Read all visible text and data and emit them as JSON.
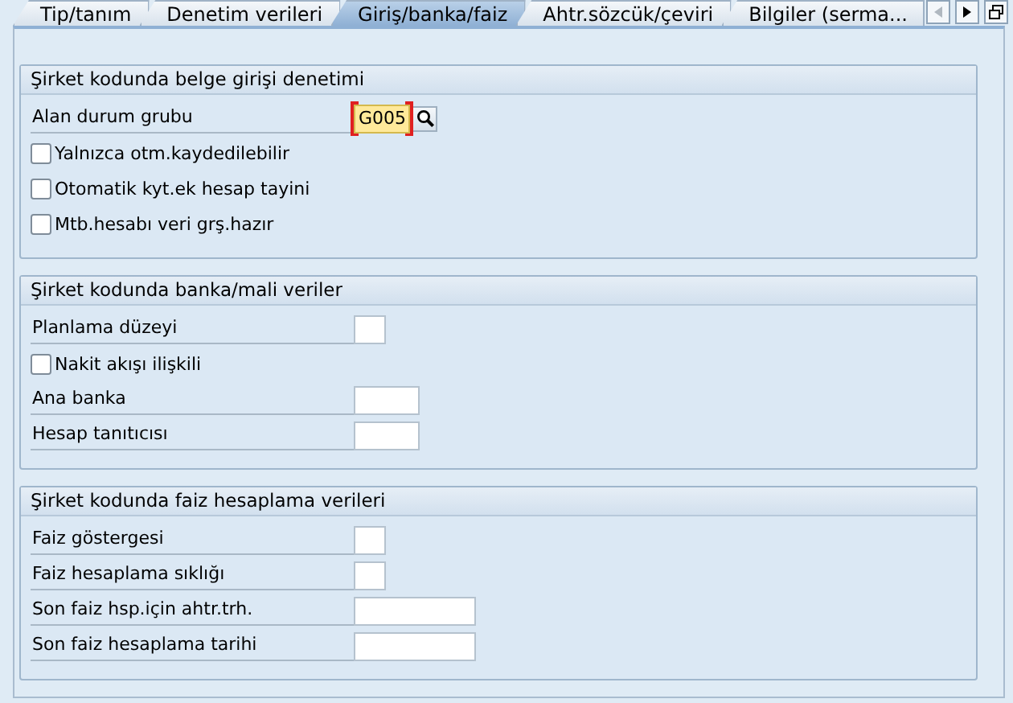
{
  "tabs": [
    {
      "label": "Tip/tanım",
      "selected": false
    },
    {
      "label": "Denetim verileri",
      "selected": false
    },
    {
      "label": "Giriş/banka/faiz",
      "selected": true
    },
    {
      "label": "Ahtr.sözcük/çeviri",
      "selected": false
    },
    {
      "label": "Bilgiler (serma...",
      "selected": false
    }
  ],
  "groups": [
    {
      "title": "Şirket kodunda belge girişi denetimi",
      "rows": [
        {
          "kind": "code_field",
          "label": "Alan durum grubu",
          "value": "G005",
          "focused": true,
          "search_help": true
        },
        {
          "kind": "checkbox",
          "label": "Yalnızca otm.kaydedilebilir",
          "checked": false
        },
        {
          "kind": "checkbox",
          "label": "Otomatik kyt.ek hesap tayini",
          "checked": false
        },
        {
          "kind": "checkbox",
          "label": "Mtb.hesabı veri grş.hazır",
          "checked": false
        }
      ]
    },
    {
      "title": "Şirket kodunda banka/mali veriler",
      "rows": [
        {
          "kind": "short_field",
          "label": "Planlama düzeyi"
        },
        {
          "kind": "checkbox",
          "label": "Nakit akışı ilişkili",
          "checked": false
        },
        {
          "kind": "medium_field",
          "label": "Ana banka"
        },
        {
          "kind": "medium_field",
          "label": "Hesap tanıtıcısı"
        }
      ]
    },
    {
      "title": "Şirket kodunda faiz hesaplama verileri",
      "rows": [
        {
          "kind": "short_field",
          "label": "Faiz göstergesi"
        },
        {
          "kind": "short_field",
          "label": "Faiz hesaplama sıklığı"
        },
        {
          "kind": "long_field",
          "label": "Son faiz hsp.için ahtr.trh."
        },
        {
          "kind": "long_field",
          "label": "Son faiz hesaplama tarihi"
        }
      ]
    }
  ]
}
